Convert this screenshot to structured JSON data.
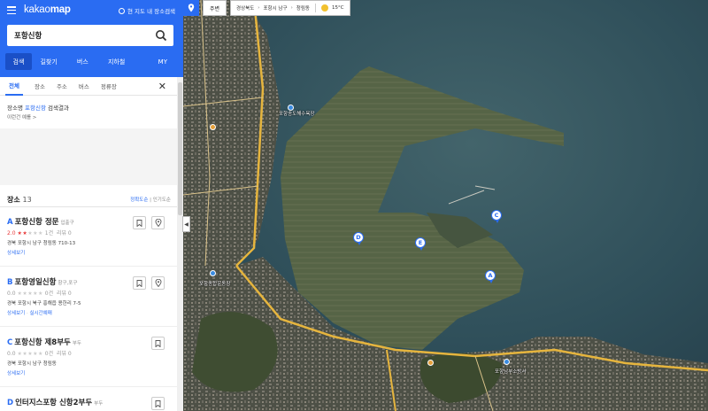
{
  "app": {
    "logo_a": "kakao",
    "logo_b": "map",
    "view_search": "현 지도 내 장소검색"
  },
  "search": {
    "value": "포항신항",
    "placeholder": ""
  },
  "tabs": [
    "검색",
    "길찾기",
    "버스",
    "지하철",
    "MY"
  ],
  "subtabs": [
    "전체",
    "장소",
    "주소",
    "버스",
    "정류장"
  ],
  "result": {
    "prefix": "장소명",
    "keyword": "포항신항",
    "suffix": "검색결과",
    "example": "이런건 예를 >"
  },
  "list": {
    "title": "장소",
    "count": "13",
    "sort_active": "정확도순",
    "sort_other": "인기도순",
    "items": [
      {
        "letter": "A",
        "name": "포항신항 정문",
        "category": "입출구",
        "score": "2.0",
        "stars_on": "★★",
        "stars_off": "★★★",
        "count_prefix": "1건",
        "review": "리뷰 0",
        "address": "경북 포항시 남구 청림동 710-13",
        "link1": "상세보기",
        "link2": ""
      },
      {
        "letter": "B",
        "name": "포항영일신항",
        "category": "항구,포구",
        "score": "0.0",
        "stars_on": "",
        "stars_off": "★★★★★",
        "count_prefix": "0건",
        "review": "리뷰 0",
        "address": "경북 포항시 북구 흥해읍 용한리 7-5",
        "link1": "상세보기",
        "link2": "실시간예매"
      },
      {
        "letter": "C",
        "name": "포항신항 제8부두",
        "category": "부두",
        "score": "0.0",
        "stars_on": "",
        "stars_off": "★★★★★",
        "count_prefix": "0건",
        "review": "리뷰 0",
        "address": "경북 포항시 남구 청림동",
        "link1": "상세보기",
        "link2": ""
      },
      {
        "letter": "D",
        "name": "인터지스포항 신항2부두",
        "category": "부두",
        "score": "",
        "stars_on": "",
        "stars_off": "",
        "count_prefix": "",
        "review": "",
        "address": "",
        "link1": "",
        "link2": ""
      }
    ]
  },
  "map": {
    "near_btn": "주변",
    "crumbs": [
      "경상북도",
      "포항시 남구",
      "청림동"
    ],
    "temp": "15°C",
    "markers": [
      "A",
      "C",
      "D",
      "E"
    ],
    "labels": {
      "coast": "포항송도해수욕장",
      "station": "포항종합운동장",
      "school": "포항남부소방서"
    }
  },
  "colors": {
    "brand": "#2a6cf2",
    "water": "#2f4f5a",
    "land": "#5c6a4c"
  }
}
